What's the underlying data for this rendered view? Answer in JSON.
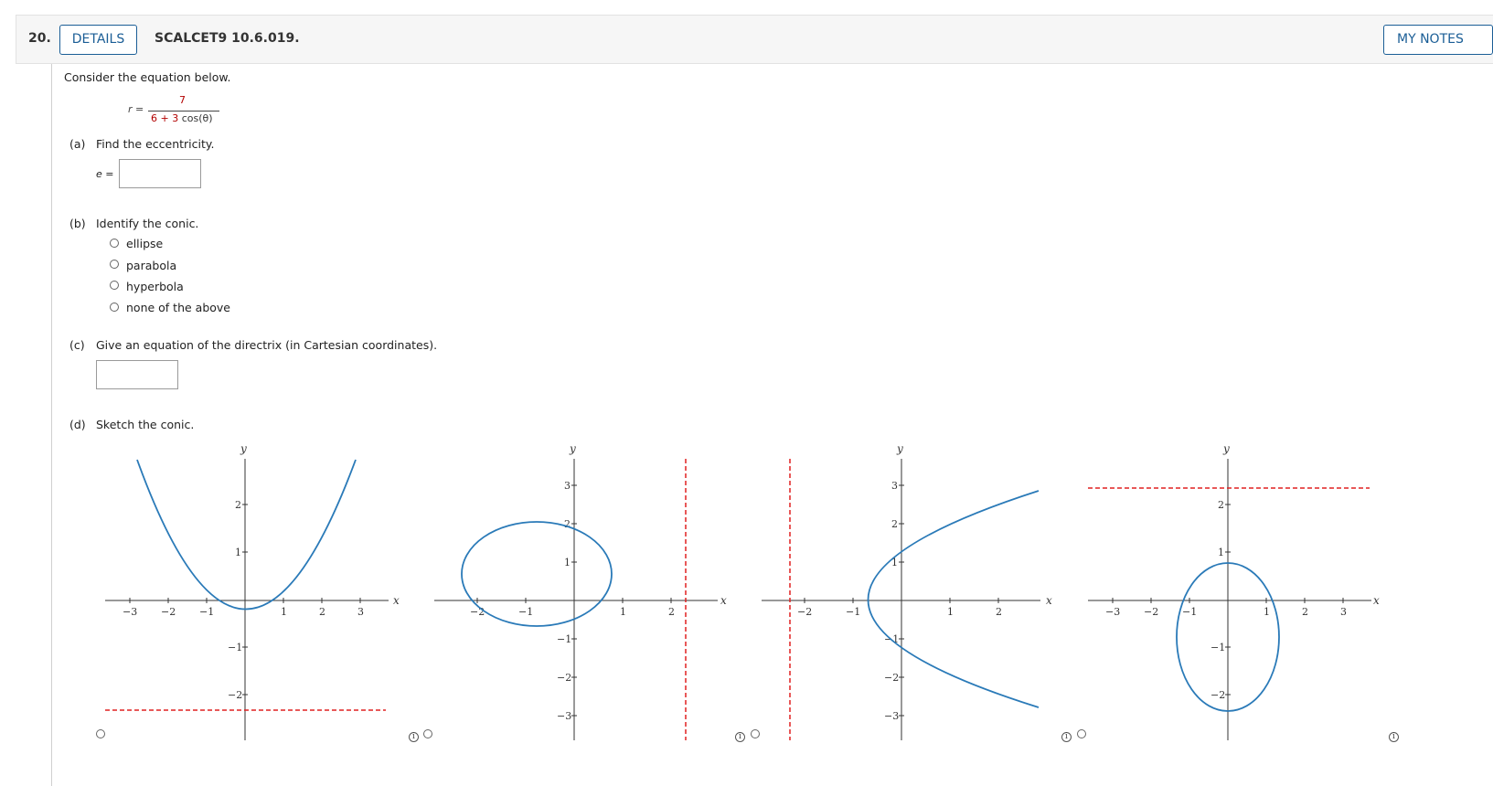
{
  "header": {
    "question_number": "20.",
    "details_label": "DETAILS",
    "question_id": "SCALCET9 10.6.019.",
    "my_notes_label": "MY NOTES"
  },
  "problem": {
    "intro": "Consider the equation below.",
    "equation": {
      "lhs": "r =",
      "numerator": "7",
      "denominator_coef": "6 + 3",
      "denominator_func": " cos(θ)"
    }
  },
  "part_a": {
    "label": "(a)",
    "prompt": "Find the eccentricity.",
    "var_label": "e =",
    "value": ""
  },
  "part_b": {
    "label": "(b)",
    "prompt": "Identify the conic.",
    "options": [
      "ellipse",
      "parabola",
      "hyperbola",
      "none of the above"
    ]
  },
  "part_c": {
    "label": "(c)",
    "prompt": "Give an equation of the directrix (in Cartesian coordinates).",
    "value": ""
  },
  "part_d": {
    "label": "(d)",
    "prompt": "Sketch the conic.",
    "axis_x": "x",
    "axis_y": "y",
    "graphs": [
      {
        "description": "upward parabola with horizontal directrix below",
        "x_ticks": [
          "−3",
          "−2",
          "−1",
          "1",
          "2",
          "3"
        ],
        "y_ticks": [
          "2",
          "1",
          "−1",
          "−2"
        ],
        "directrix": "y = -2.3"
      },
      {
        "description": "horizontal ellipse left of origin with vertical directrix on right",
        "x_ticks": [
          "−2",
          "−1",
          "1",
          "2"
        ],
        "y_ticks": [
          "3",
          "2",
          "1",
          "−1",
          "−2",
          "−3"
        ],
        "directrix": "x = 2.3"
      },
      {
        "description": "right-opening parabola with vertical directrix on left",
        "x_ticks": [
          "−2",
          "−1",
          "1",
          "2"
        ],
        "y_ticks": [
          "3",
          "2",
          "1",
          "−1",
          "−2",
          "−3"
        ],
        "directrix": "x = -2.3"
      },
      {
        "description": "vertical ellipse below origin with horizontal directrix above",
        "x_ticks": [
          "−3",
          "−2",
          "−1",
          "1",
          "2",
          "3"
        ],
        "y_ticks": [
          "2",
          "1",
          "−1",
          "−2"
        ],
        "directrix": "y = 2.3"
      }
    ]
  },
  "colors": {
    "curve": "#2a7ab8",
    "directrix": "#e02020",
    "accent": "#1b5e96"
  }
}
